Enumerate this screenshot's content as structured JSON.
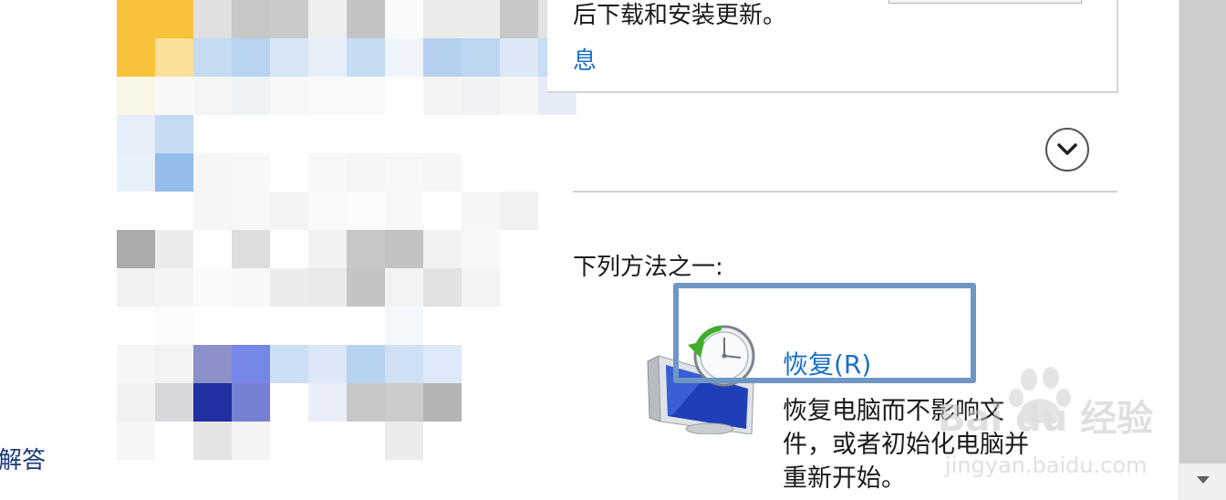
{
  "left_panel": {
    "answer_text": "解答",
    "mosaic": [
      [
        "#f8c33a",
        "#f8c33a",
        "#e0e0e0",
        "#c8c8c8",
        "#cacaca",
        "#f0f0f0",
        "#c4c4c4",
        "#fafafa",
        "#ebebeb",
        "#ececec",
        "#c8c8c8",
        "#e2e2e2"
      ],
      [
        "#f8c33a",
        "#fbe09a",
        "#c4dbf2",
        "#b9d4f0",
        "#d8e7f7",
        "#e6eef9",
        "#c6dcf3",
        "#f0f5fb",
        "#b5cfee",
        "#bcd5f1",
        "#dce8f8",
        "#c8dcf3"
      ],
      [
        "#fbf7e6",
        "#f8f8f8",
        "#f5f5f5",
        "#eff3f8",
        "#f7f7f7",
        "#f9f9f9",
        "#f9f9f9",
        "#ffffff",
        "#f4f4f4",
        "#f1f2f5",
        "#f6f6f6",
        "#e6edf8"
      ],
      [
        "#e6eef9",
        "#c4dbf2",
        "#ffffff",
        "#ffffff",
        "#ffffff",
        "#ffffff",
        "#ffffff",
        "#ffffff",
        "#ffffff",
        "#ffffff",
        "#ffffff",
        "#ffffff"
      ],
      [
        "#e8f0fa",
        "#94bdea",
        "#f6f6f6",
        "#f8f8f8",
        "#ffffff",
        "#f8f8f8",
        "#f6f6f6",
        "#f8f8f8",
        "#f6f6f6",
        "#ffffff",
        "#ffffff",
        "#ffffff"
      ],
      [
        "#ffffff",
        "#ffffff",
        "#f6f6f6",
        "#f7f7f7",
        "#f4f4f4",
        "#fafafa",
        "#fbfbfb",
        "#f8f8f8",
        "#ffffff",
        "#f6f6f6",
        "#f1f1f1",
        "#ffffff"
      ],
      [
        "#ababab",
        "#ececec",
        "#ffffff",
        "#dedede",
        "#ffffff",
        "#f2f2f2",
        "#c8c8c8",
        "#c2c2c2",
        "#f2f2f2",
        "#f8f8f8",
        "#ffffff",
        "#ffffff"
      ],
      [
        "#f2f2f2",
        "#f4f4f4",
        "#fafafa",
        "#f8f8f8",
        "#ececec",
        "#eaeaea",
        "#c4c4c4",
        "#f3f3f3",
        "#e2e2e2",
        "#f3f3f3",
        "#ffffff",
        "#ffffff"
      ],
      [
        "#ffffff",
        "#fbfbfb",
        "#ffffff",
        "#ffffff",
        "#ffffff",
        "#ffffff",
        "#ffffff",
        "#f4f7fb",
        "#ffffff",
        "#ffffff",
        "#ffffff",
        "#ffffff"
      ],
      [
        "#f6f6f6",
        "#f3f3f3",
        "#8b90c8",
        "#7787e8",
        "#cddff5",
        "#dce8f8",
        "#b8d2f1",
        "#d0e0f5",
        "#dde8f8",
        "#ffffff",
        "#ffffff",
        "#ffffff"
      ],
      [
        "#f2f2f2",
        "#d8d8dc",
        "#2030a0",
        "#7680d2",
        "#ffffff",
        "#e9eef8",
        "#c8c8c8",
        "#cbcbcb",
        "#b4b4b4",
        "#ffffff",
        "#ffffff",
        "#ffffff"
      ],
      [
        "#f6f6f6",
        "#ffffff",
        "#e4e4e6",
        "#f4f4f4",
        "#ffffff",
        "#ffffff",
        "#ffffff",
        "#ececec",
        "#ffffff",
        "#ffffff",
        "#ffffff",
        "#ffffff"
      ]
    ]
  },
  "update_section": {
    "text": "后下载和安装更新。",
    "link_text": "息"
  },
  "instruction": {
    "text": "下列方法之一:"
  },
  "recovery_option": {
    "title": "恢复(R)",
    "description": "恢复电脑而不影响文件，或者初始化电脑并重新开始。",
    "icon": "system-restore-icon"
  },
  "expand_button": {
    "icon": "chevron-down-icon"
  },
  "scrollbar": {
    "arrow_icon": "scroll-down-arrow-icon"
  },
  "watermark": {
    "brand": "Bai du 经验",
    "url": "jingyan.baidu.com"
  },
  "colors": {
    "link": "#1a6fc8",
    "highlight_border": "#7096c4",
    "divider": "#d0d0d0"
  }
}
